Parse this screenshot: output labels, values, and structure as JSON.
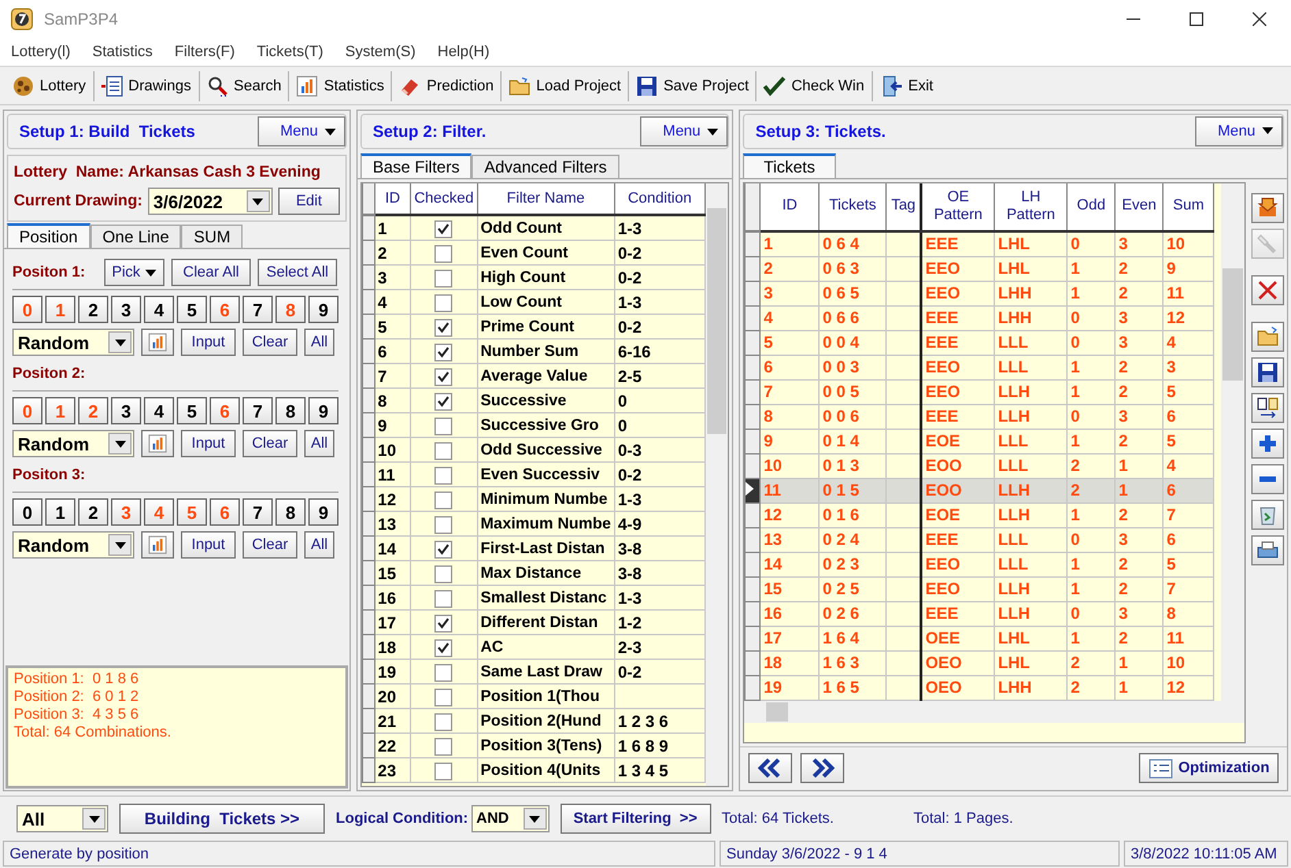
{
  "window": {
    "title": "SamP3P4"
  },
  "menu": [
    "Lottery(l)",
    "Statistics",
    "Filters(F)",
    "Tickets(T)",
    "System(S)",
    "Help(H)"
  ],
  "toolbar": [
    {
      "label": "Lottery",
      "kind": "lottery"
    },
    {
      "label": "Drawings",
      "kind": "drawings"
    },
    {
      "label": "Search",
      "kind": "search"
    },
    {
      "label": "Statistics",
      "kind": "statistics"
    },
    {
      "label": "Prediction",
      "kind": "prediction"
    },
    {
      "label": "Load Project",
      "kind": "load"
    },
    {
      "label": "Save Project",
      "kind": "save"
    },
    {
      "label": "Check Win",
      "kind": "check"
    },
    {
      "label": "Exit",
      "kind": "exit"
    }
  ],
  "setup1": {
    "title": "Setup 1: Build  Tickets",
    "menu": "Menu",
    "lottery_name": "Lottery  Name: Arkansas Cash 3 Evening",
    "drawing_label": "Current Drawing:",
    "drawing": "3/6/2022",
    "edit": "Edit",
    "tabs": [
      {
        "label": "Position",
        "selected": true
      },
      {
        "label": "One Line",
        "selected": false
      },
      {
        "label": "SUM",
        "selected": false
      }
    ],
    "pick": "Pick",
    "clear_all": "Clear All",
    "select_all": "Select All",
    "positions": [
      {
        "label": "Positon 1:",
        "mode": "Random",
        "input": "Input",
        "clear": "Clear",
        "all": "All",
        "digits": [
          {
            "d": "0",
            "highlighted": true
          },
          {
            "d": "1",
            "highlighted": true
          },
          {
            "d": "2",
            "highlighted": false
          },
          {
            "d": "3",
            "highlighted": false
          },
          {
            "d": "4",
            "highlighted": false
          },
          {
            "d": "5",
            "highlighted": false
          },
          {
            "d": "6",
            "highlighted": true
          },
          {
            "d": "7",
            "highlighted": false
          },
          {
            "d": "8",
            "highlighted": true
          },
          {
            "d": "9",
            "highlighted": false
          }
        ]
      },
      {
        "label": "Positon 2:",
        "mode": "Random",
        "input": "Input",
        "clear": "Clear",
        "all": "All",
        "digits": [
          {
            "d": "0",
            "highlighted": true
          },
          {
            "d": "1",
            "highlighted": true
          },
          {
            "d": "2",
            "highlighted": true
          },
          {
            "d": "3",
            "highlighted": false
          },
          {
            "d": "4",
            "highlighted": false
          },
          {
            "d": "5",
            "highlighted": false
          },
          {
            "d": "6",
            "highlighted": true
          },
          {
            "d": "7",
            "highlighted": false
          },
          {
            "d": "8",
            "highlighted": false
          },
          {
            "d": "9",
            "highlighted": false
          }
        ]
      },
      {
        "label": "Positon 3:",
        "mode": "Random",
        "input": "Input",
        "clear": "Clear",
        "all": "All",
        "digits": [
          {
            "d": "0",
            "highlighted": false
          },
          {
            "d": "1",
            "highlighted": false
          },
          {
            "d": "2",
            "highlighted": false
          },
          {
            "d": "3",
            "highlighted": true
          },
          {
            "d": "4",
            "highlighted": true
          },
          {
            "d": "5",
            "highlighted": true
          },
          {
            "d": "6",
            "highlighted": true
          },
          {
            "d": "7",
            "highlighted": false
          },
          {
            "d": "8",
            "highlighted": false
          },
          {
            "d": "9",
            "highlighted": false
          }
        ]
      }
    ],
    "summary": [
      "Position 1:  0 1 8 6",
      "Position 2:  6 0 1 2",
      "Position 3:  4 3 5 6",
      "Total: 64 Combinations."
    ]
  },
  "setup2": {
    "title": "Setup 2: Filter.",
    "menu": "Menu",
    "tabs": [
      {
        "label": "Base Filters",
        "selected": true
      },
      {
        "label": "Advanced Filters",
        "selected": false
      }
    ],
    "columns": [
      "ID",
      "Checked",
      "Filter Name",
      "Condition"
    ],
    "rows": [
      {
        "id": "1",
        "checked": true,
        "name": "Odd Count",
        "condition": "1-3"
      },
      {
        "id": "2",
        "checked": false,
        "name": "Even Count",
        "condition": "0-2"
      },
      {
        "id": "3",
        "checked": false,
        "name": "High Count",
        "condition": "0-2"
      },
      {
        "id": "4",
        "checked": false,
        "name": "Low Count",
        "condition": "1-3"
      },
      {
        "id": "5",
        "checked": true,
        "name": "Prime Count",
        "condition": "0-2"
      },
      {
        "id": "6",
        "checked": true,
        "name": "Number Sum",
        "condition": "6-16"
      },
      {
        "id": "7",
        "checked": true,
        "name": "Average Value",
        "condition": "2-5"
      },
      {
        "id": "8",
        "checked": true,
        "name": "Successive",
        "condition": "0"
      },
      {
        "id": "9",
        "checked": false,
        "name": "Successive Gro",
        "condition": "0"
      },
      {
        "id": "10",
        "checked": false,
        "name": "Odd Successive",
        "condition": "0-3"
      },
      {
        "id": "11",
        "checked": false,
        "name": "Even Successiv",
        "condition": "0-2"
      },
      {
        "id": "12",
        "checked": false,
        "name": "Minimum Numbe",
        "condition": "1-3"
      },
      {
        "id": "13",
        "checked": false,
        "name": "Maximum Numbe",
        "condition": "4-9"
      },
      {
        "id": "14",
        "checked": true,
        "name": "First-Last Distan",
        "condition": "3-8"
      },
      {
        "id": "15",
        "checked": false,
        "name": "Max Distance",
        "condition": "3-8"
      },
      {
        "id": "16",
        "checked": false,
        "name": "Smallest Distanc",
        "condition": "1-3"
      },
      {
        "id": "17",
        "checked": true,
        "name": "Different Distan",
        "condition": "1-2"
      },
      {
        "id": "18",
        "checked": true,
        "name": "AC",
        "condition": "2-3"
      },
      {
        "id": "19",
        "checked": false,
        "name": "Same Last Draw",
        "condition": "0-2"
      },
      {
        "id": "20",
        "checked": false,
        "name": "Position 1(Thou"
      },
      {
        "id": "21",
        "checked": false,
        "name": "Position 2(Hund",
        "condition": "1 2 3 6"
      },
      {
        "id": "22",
        "checked": false,
        "name": "Position 3(Tens)",
        "condition": "1 6 8 9"
      },
      {
        "id": "23",
        "checked": false,
        "name": "Position 4(Units",
        "condition": "1 3 4 5"
      }
    ]
  },
  "setup3": {
    "title": "Setup 3: Tickets.",
    "menu": "Menu",
    "tabs": [
      {
        "label": "Tickets",
        "selected": true
      }
    ],
    "columns": [
      "ID",
      "Tickets",
      "Tag",
      "OE Pattern",
      "LH Pattern",
      "Odd",
      "Even",
      "Sum"
    ],
    "rows": [
      {
        "id": "1",
        "tickets": "0 6 4",
        "oe": "EEE",
        "lh": "LHL",
        "odd": "0",
        "even": "3",
        "sum": "10",
        "selected": false
      },
      {
        "id": "2",
        "tickets": "0 6 3",
        "oe": "EEO",
        "lh": "LHL",
        "odd": "1",
        "even": "2",
        "sum": "9",
        "selected": false
      },
      {
        "id": "3",
        "tickets": "0 6 5",
        "oe": "EEO",
        "lh": "LHH",
        "odd": "1",
        "even": "2",
        "sum": "11",
        "selected": false
      },
      {
        "id": "4",
        "tickets": "0 6 6",
        "oe": "EEE",
        "lh": "LHH",
        "odd": "0",
        "even": "3",
        "sum": "12",
        "selected": false
      },
      {
        "id": "5",
        "tickets": "0 0 4",
        "oe": "EEE",
        "lh": "LLL",
        "odd": "0",
        "even": "3",
        "sum": "4",
        "selected": false
      },
      {
        "id": "6",
        "tickets": "0 0 3",
        "oe": "EEO",
        "lh": "LLL",
        "odd": "1",
        "even": "2",
        "sum": "3",
        "selected": false
      },
      {
        "id": "7",
        "tickets": "0 0 5",
        "oe": "EEO",
        "lh": "LLH",
        "odd": "1",
        "even": "2",
        "sum": "5",
        "selected": false
      },
      {
        "id": "8",
        "tickets": "0 0 6",
        "oe": "EEE",
        "lh": "LLH",
        "odd": "0",
        "even": "3",
        "sum": "6",
        "selected": false
      },
      {
        "id": "9",
        "tickets": "0 1 4",
        "oe": "EOE",
        "lh": "LLL",
        "odd": "1",
        "even": "2",
        "sum": "5",
        "selected": false
      },
      {
        "id": "10",
        "tickets": "0 1 3",
        "oe": "EOO",
        "lh": "LLL",
        "odd": "2",
        "even": "1",
        "sum": "4",
        "selected": false
      },
      {
        "id": "11",
        "tickets": "0 1 5",
        "oe": "EOO",
        "lh": "LLH",
        "odd": "2",
        "even": "1",
        "sum": "6",
        "selected": true
      },
      {
        "id": "12",
        "tickets": "0 1 6",
        "oe": "EOE",
        "lh": "LLH",
        "odd": "1",
        "even": "2",
        "sum": "7",
        "selected": false
      },
      {
        "id": "13",
        "tickets": "0 2 4",
        "oe": "EEE",
        "lh": "LLL",
        "odd": "0",
        "even": "3",
        "sum": "6",
        "selected": false
      },
      {
        "id": "14",
        "tickets": "0 2 3",
        "oe": "EEO",
        "lh": "LLL",
        "odd": "1",
        "even": "2",
        "sum": "5",
        "selected": false
      },
      {
        "id": "15",
        "tickets": "0 2 5",
        "oe": "EEO",
        "lh": "LLH",
        "odd": "1",
        "even": "2",
        "sum": "7",
        "selected": false
      },
      {
        "id": "16",
        "tickets": "0 2 6",
        "oe": "EEE",
        "lh": "LLH",
        "odd": "0",
        "even": "3",
        "sum": "8",
        "selected": false
      },
      {
        "id": "17",
        "tickets": "1 6 4",
        "oe": "OEE",
        "lh": "LHL",
        "odd": "1",
        "even": "2",
        "sum": "11",
        "selected": false
      },
      {
        "id": "18",
        "tickets": "1 6 3",
        "oe": "OEO",
        "lh": "LHL",
        "odd": "2",
        "even": "1",
        "sum": "10",
        "selected": false
      },
      {
        "id": "19",
        "tickets": "1 6 5",
        "oe": "OEO",
        "lh": "LHH",
        "odd": "2",
        "even": "1",
        "sum": "12",
        "selected": false
      }
    ],
    "tools": [
      {
        "kind": "import"
      },
      {
        "kind": "flashlight",
        "disabled": true
      },
      {
        "kind": "delete"
      },
      {
        "kind": "open"
      },
      {
        "kind": "save"
      },
      {
        "kind": "copy"
      },
      {
        "kind": "add"
      },
      {
        "kind": "remove"
      },
      {
        "kind": "recycle"
      },
      {
        "kind": "print"
      }
    ],
    "optimization": "Optimization"
  },
  "bottom": {
    "scope": "All",
    "build": "Building  Tickets >>",
    "logic_label": "Logical Condition:",
    "logic": "AND",
    "start": "Start Filtering  >>",
    "total_tickets": "Total: 64 Tickets.",
    "total_pages": "Total: 1 Pages."
  },
  "status_bar": [
    "Generate by position",
    "Sunday 3/6/2022 - 9 1 4",
    "3/8/2022 10:11:05 AM"
  ]
}
